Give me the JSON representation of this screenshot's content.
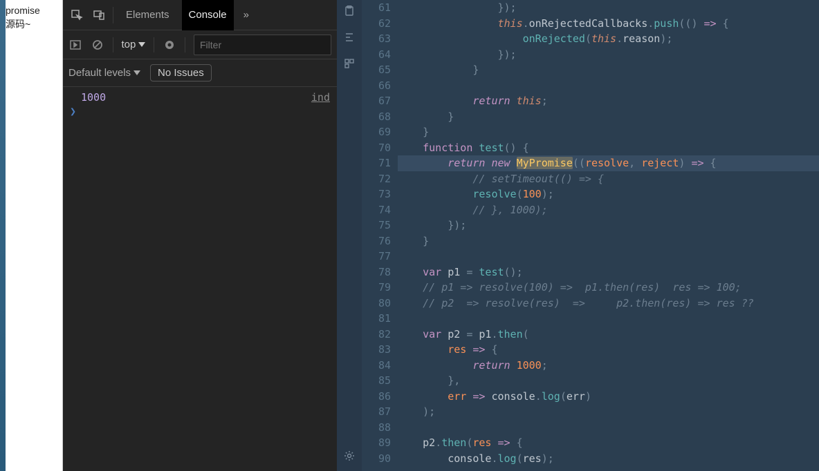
{
  "leftPane": {
    "line1": "promise",
    "line2": "源码~"
  },
  "devtools": {
    "tabs": {
      "elements": "Elements",
      "console": "Console",
      "more": "»"
    },
    "toolbar": {
      "context": "top",
      "filter_placeholder": "Filter"
    },
    "levels": {
      "label": "Default levels",
      "issues": "No Issues"
    },
    "log": {
      "value": "1000",
      "source": "ind",
      "prompt": "❯"
    }
  },
  "editor": {
    "startLine": 61,
    "lines": [
      {
        "n": 61,
        "indent": 8,
        "tokens": [
          [
            "pn",
            "});"
          ]
        ]
      },
      {
        "n": 62,
        "indent": 8,
        "tokens": [
          [
            "this",
            "this"
          ],
          [
            "pn",
            "."
          ],
          [
            "prop",
            "onRejectedCallbacks"
          ],
          [
            "pn",
            "."
          ],
          [
            "fncall",
            "push"
          ],
          [
            "pn",
            "(() "
          ],
          [
            "op",
            "=>"
          ],
          [
            "pn",
            " {"
          ]
        ]
      },
      {
        "n": 63,
        "indent": 10,
        "tokens": [
          [
            "fncall",
            "onRejected"
          ],
          [
            "pn",
            "("
          ],
          [
            "this",
            "this"
          ],
          [
            "pn",
            "."
          ],
          [
            "prop",
            "reason"
          ],
          [
            "pn",
            ");"
          ]
        ]
      },
      {
        "n": 64,
        "indent": 8,
        "tokens": [
          [
            "pn",
            "});"
          ]
        ]
      },
      {
        "n": 65,
        "indent": 6,
        "tokens": [
          [
            "pn",
            "}"
          ]
        ]
      },
      {
        "n": 66,
        "indent": 0,
        "tokens": []
      },
      {
        "n": 67,
        "indent": 6,
        "tokens": [
          [
            "kw",
            "return "
          ],
          [
            "this",
            "this"
          ],
          [
            "pn",
            ";"
          ]
        ]
      },
      {
        "n": 68,
        "indent": 4,
        "tokens": [
          [
            "pn",
            "}"
          ]
        ]
      },
      {
        "n": 69,
        "indent": 2,
        "tokens": [
          [
            "pn",
            "}"
          ]
        ]
      },
      {
        "n": 70,
        "indent": 2,
        "tokens": [
          [
            "kw2",
            "function "
          ],
          [
            "fn",
            "test"
          ],
          [
            "pn",
            "() {"
          ]
        ]
      },
      {
        "n": 71,
        "indent": 4,
        "hl": true,
        "tokens": [
          [
            "kw",
            "return "
          ],
          [
            "kw",
            "new "
          ],
          [
            "typhl",
            "MyPromise"
          ],
          [
            "pn",
            "(("
          ],
          [
            "param",
            "resolve"
          ],
          [
            "pn",
            ", "
          ],
          [
            "param",
            "reject"
          ],
          [
            "pn",
            ") "
          ],
          [
            "op",
            "=>"
          ],
          [
            "pn",
            " {"
          ]
        ]
      },
      {
        "n": 72,
        "indent": 6,
        "tokens": [
          [
            "cm",
            "// setTimeout(() => {"
          ]
        ]
      },
      {
        "n": 73,
        "indent": 6,
        "tokens": [
          [
            "fncall",
            "resolve"
          ],
          [
            "pn",
            "("
          ],
          [
            "num",
            "100"
          ],
          [
            "pn",
            ");"
          ]
        ]
      },
      {
        "n": 74,
        "indent": 6,
        "tokens": [
          [
            "cm",
            "// }, 1000);"
          ]
        ]
      },
      {
        "n": 75,
        "indent": 4,
        "tokens": [
          [
            "pn",
            "});"
          ]
        ]
      },
      {
        "n": 76,
        "indent": 2,
        "tokens": [
          [
            "pn",
            "}"
          ]
        ]
      },
      {
        "n": 77,
        "indent": 0,
        "tokens": []
      },
      {
        "n": 78,
        "indent": 2,
        "tokens": [
          [
            "kw2",
            "var "
          ],
          [
            "prop",
            "p1"
          ],
          [
            "pn",
            " = "
          ],
          [
            "fncall",
            "test"
          ],
          [
            "pn",
            "();"
          ]
        ]
      },
      {
        "n": 79,
        "indent": 2,
        "tokens": [
          [
            "cm",
            "// p1 => resolve(100) =>  p1.then(res)  res => 100;"
          ]
        ]
      },
      {
        "n": 80,
        "indent": 2,
        "tokens": [
          [
            "cm",
            "// p2  => resolve(res)  =>     p2.then(res) => res ??"
          ]
        ]
      },
      {
        "n": 81,
        "indent": 0,
        "tokens": []
      },
      {
        "n": 82,
        "indent": 2,
        "tokens": [
          [
            "kw2",
            "var "
          ],
          [
            "prop",
            "p2"
          ],
          [
            "pn",
            " = "
          ],
          [
            "prop",
            "p1"
          ],
          [
            "pn",
            "."
          ],
          [
            "fncall",
            "then"
          ],
          [
            "pn",
            "("
          ]
        ]
      },
      {
        "n": 83,
        "indent": 4,
        "tokens": [
          [
            "param",
            "res"
          ],
          [
            "pn",
            " "
          ],
          [
            "op",
            "=>"
          ],
          [
            "pn",
            " {"
          ]
        ]
      },
      {
        "n": 84,
        "indent": 6,
        "tokens": [
          [
            "kw",
            "return "
          ],
          [
            "num",
            "1000"
          ],
          [
            "pn",
            ";"
          ]
        ]
      },
      {
        "n": 85,
        "indent": 4,
        "tokens": [
          [
            "pn",
            "},"
          ]
        ]
      },
      {
        "n": 86,
        "indent": 4,
        "tokens": [
          [
            "param",
            "err"
          ],
          [
            "pn",
            " "
          ],
          [
            "op",
            "=>"
          ],
          [
            "pn",
            " "
          ],
          [
            "prop",
            "console"
          ],
          [
            "pn",
            "."
          ],
          [
            "fncall",
            "log"
          ],
          [
            "pn",
            "("
          ],
          [
            "prop",
            "err"
          ],
          [
            "pn",
            ")"
          ]
        ]
      },
      {
        "n": 87,
        "indent": 2,
        "tokens": [
          [
            "pn",
            ");"
          ]
        ]
      },
      {
        "n": 88,
        "indent": 0,
        "tokens": []
      },
      {
        "n": 89,
        "indent": 2,
        "tokens": [
          [
            "prop",
            "p2"
          ],
          [
            "pn",
            "."
          ],
          [
            "fncall",
            "then"
          ],
          [
            "pn",
            "("
          ],
          [
            "param",
            "res"
          ],
          [
            "pn",
            " "
          ],
          [
            "op",
            "=>"
          ],
          [
            "pn",
            " {"
          ]
        ]
      },
      {
        "n": 90,
        "indent": 4,
        "tokens": [
          [
            "prop",
            "console"
          ],
          [
            "pn",
            "."
          ],
          [
            "fncall",
            "log"
          ],
          [
            "pn",
            "("
          ],
          [
            "prop",
            "res"
          ],
          [
            "pn",
            ");"
          ]
        ]
      }
    ]
  }
}
